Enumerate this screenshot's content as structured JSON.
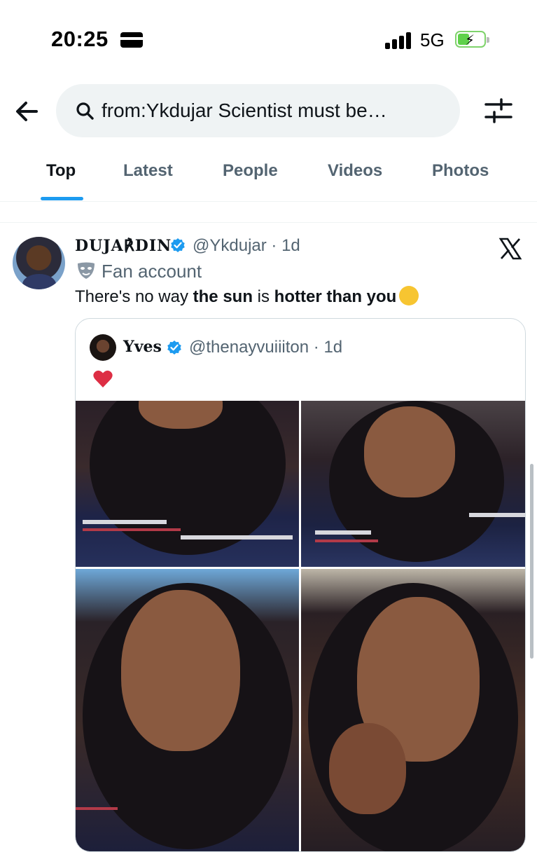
{
  "status_bar": {
    "time": "20:25",
    "network": "5G"
  },
  "search": {
    "query": "from:Ykdujar Scientist must be…"
  },
  "tabs": [
    "Top",
    "Latest",
    "People",
    "Videos",
    "Photos"
  ],
  "active_tab": "Top",
  "tweet": {
    "display_name": "DUJA℟DIN",
    "handle_time": "@Ykdujar · 1d",
    "label": "Fan account",
    "text_parts": [
      "There's no way ",
      "the sun",
      " is ",
      "hotter than you"
    ]
  },
  "quote": {
    "display_name": "Yves",
    "handle_time": "@thenayvuiiiton · 1d"
  },
  "colors": {
    "accent": "#1d9bf0",
    "secondary_text": "#536471",
    "verified": "#1d9bf0"
  }
}
